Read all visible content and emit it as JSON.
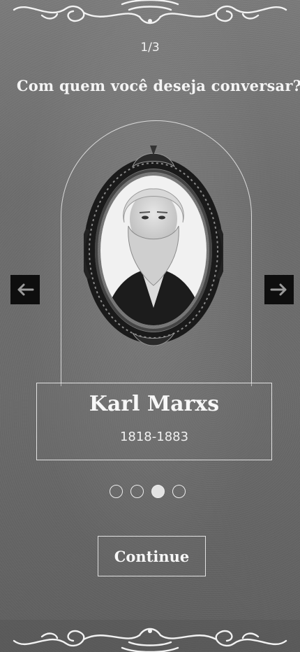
{
  "header": {
    "step": "1/3",
    "question": "Com quem você deseja conversar?"
  },
  "carousel": {
    "person": {
      "name": "Karl Marxs",
      "years": "1818-1883"
    },
    "prev_icon": "arrow-left-icon",
    "next_icon": "arrow-right-icon",
    "dots": [
      {
        "active": false
      },
      {
        "active": false
      },
      {
        "active": true
      },
      {
        "active": false
      }
    ]
  },
  "actions": {
    "continue_label": "Continue"
  },
  "colors": {
    "arrow_bg": "#0e0e0e",
    "border": "#eeeeee",
    "text": "#f4f4f4"
  }
}
